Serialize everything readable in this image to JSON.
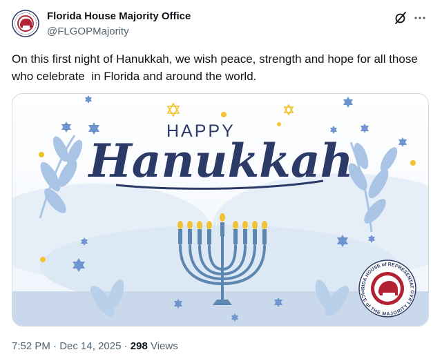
{
  "account": {
    "display_name": "Florida House Majority Office",
    "handle": "@FLGOPMajority",
    "avatar_icon": "florida-house-elephant-seal-icon"
  },
  "tweet": {
    "text": "On this first night of Hanukkah, we wish peace, strength and hope for all those who celebrate  in Florida and around the world."
  },
  "media": {
    "happy_label": "HAPPY",
    "script_title": "Hanukkah",
    "seal_text_top": "FLORIDA HOUSE of REPRESENTATIVES",
    "seal_text_bottom": "OFFICE of THE MAJORITY LEADER"
  },
  "meta": {
    "time": "7:52 PM",
    "separator1": " · ",
    "date": "Dec 14, 2025",
    "separator2": " · ",
    "views_count": "298",
    "views_label": " Views"
  },
  "colors": {
    "navy": "#2b3a67",
    "light_blue": "#a9c4e4",
    "star_blue": "#6f95cf",
    "gold": "#f1c232",
    "seal_red": "#b22234"
  }
}
